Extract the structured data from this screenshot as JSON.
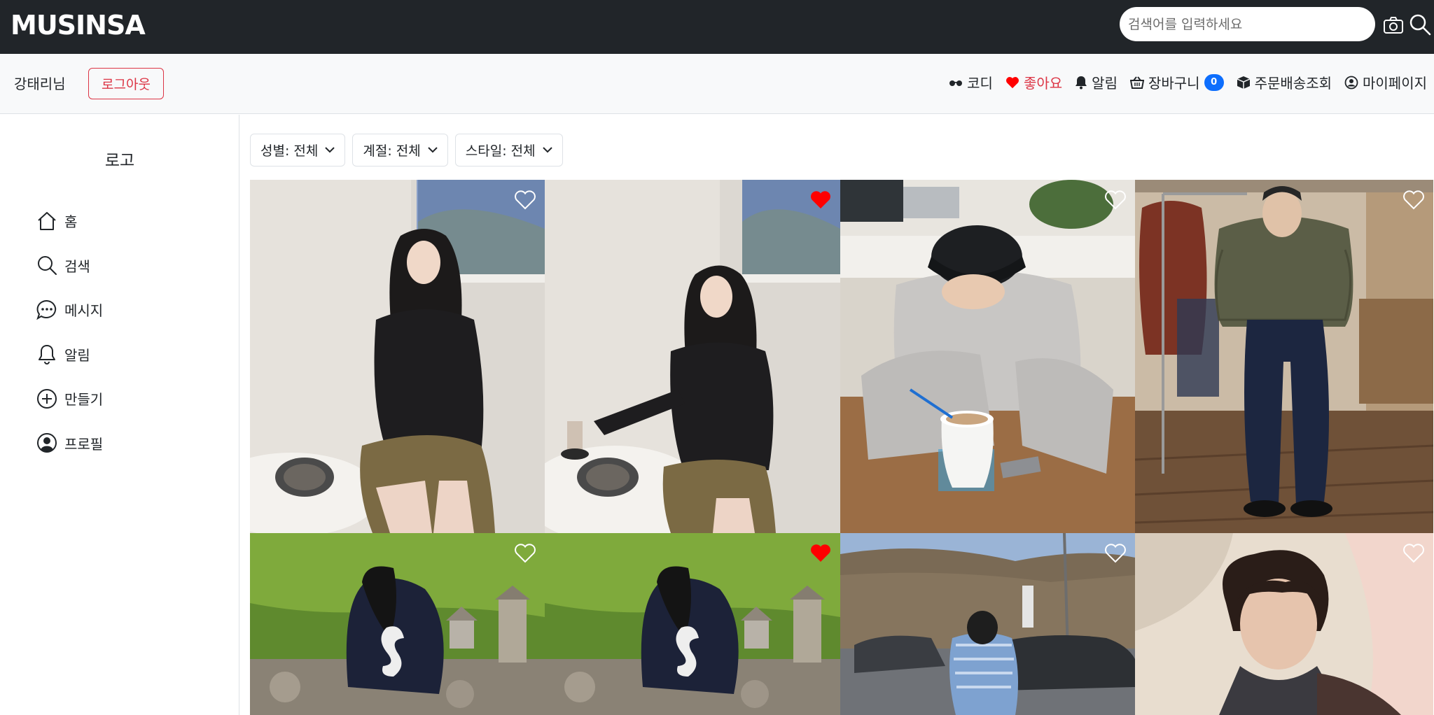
{
  "brand": "MUSINSA",
  "search": {
    "placeholder": "검색어를 입력하세요"
  },
  "user": {
    "name": "강태리님",
    "logout_label": "로그아웃"
  },
  "nav": {
    "codi_label": "코디",
    "like_label": "좋아요",
    "notify_label": "알림",
    "cart_label": "장바구니",
    "cart_count": "0",
    "order_label": "주문배송조회",
    "mypage_label": "마이페이지"
  },
  "sidebar": {
    "logo": "로고",
    "items": [
      {
        "label": "홈",
        "icon": "home-icon"
      },
      {
        "label": "검색",
        "icon": "search-icon"
      },
      {
        "label": "메시지",
        "icon": "message-icon"
      },
      {
        "label": "알림",
        "icon": "bell-icon"
      },
      {
        "label": "만들기",
        "icon": "plus-circle-icon"
      },
      {
        "label": "프로필",
        "icon": "profile-icon"
      }
    ]
  },
  "filters": [
    {
      "label": "성별: 전체"
    },
    {
      "label": "계절: 전체"
    },
    {
      "label": "스타일: 전체"
    }
  ],
  "posts": [
    {
      "liked": false,
      "subject": "woman in black top and olive skirt seated by window"
    },
    {
      "liked": true,
      "subject": "woman in black top holding a drink by window"
    },
    {
      "liked": false,
      "subject": "man in black cap and grey hoodie at cafe table"
    },
    {
      "liked": false,
      "subject": "man in olive puffer jacket and dark jeans in store"
    },
    {
      "liked": false,
      "subject": "woman in navy hoodie crouching by birdhouses"
    },
    {
      "liked": true,
      "subject": "woman in navy hoodie crouching by birdhouses"
    },
    {
      "liked": false,
      "subject": "man in striped shirt walking in parking lot"
    },
    {
      "liked": false,
      "subject": "man in dark coat portrait with warm light"
    }
  ],
  "colors": {
    "topbar": "#212529",
    "userbar": "#f8f9fa",
    "danger": "#dc3545",
    "primary": "#0d6efd",
    "like_red": "#ff0000"
  }
}
